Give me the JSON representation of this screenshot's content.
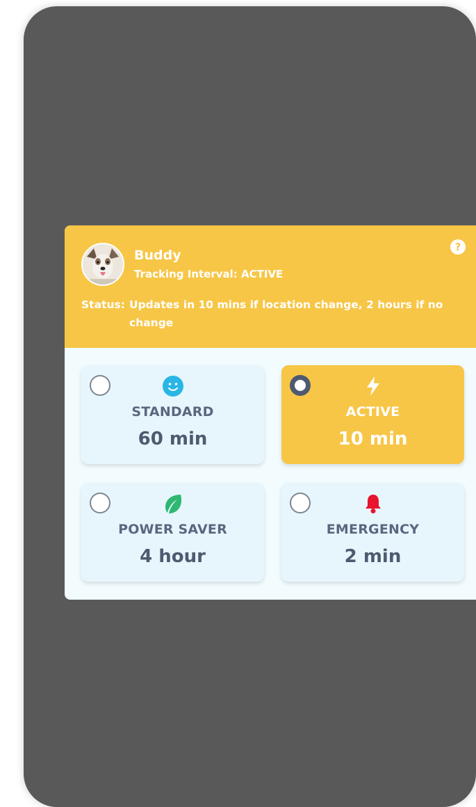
{
  "pet": {
    "name": "Buddy",
    "tracking_line": "Tracking Interval: ACTIVE",
    "status_label": "Status:",
    "status_text": "Updates in 10 mins if location change, 2 hours if no change",
    "help_glyph": "?"
  },
  "modes": [
    {
      "label": "STANDARD",
      "interval": "60 min",
      "icon": "smiley-icon",
      "icon_color": "#29b6e6",
      "selected": false
    },
    {
      "label": "ACTIVE",
      "interval": "10 min",
      "icon": "lightning-bolt-icon",
      "icon_color": "#ffffff",
      "selected": true
    },
    {
      "label": "POWER SAVER",
      "interval": "4 hour",
      "icon": "leaf-icon",
      "icon_color": "#2eb872",
      "selected": false
    },
    {
      "label": "EMERGENCY",
      "interval": "2 min",
      "icon": "bell-icon",
      "icon_color": "#e8132d",
      "selected": false
    }
  ],
  "colors": {
    "accent": "#f7c646",
    "backdrop": "#595959",
    "card_bg": "#e7f6fc",
    "text_dark": "#4f5a70"
  }
}
